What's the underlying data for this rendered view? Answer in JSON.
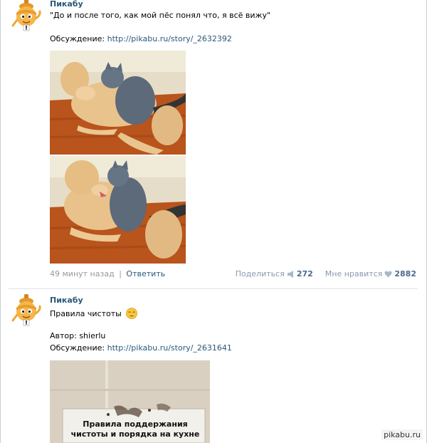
{
  "posts": [
    {
      "author": "Пикабу",
      "title": "\"До и после того, как мой пёс понял что, я всё вижу\"",
      "discussion_label": "Обсуждение:",
      "discussion_link": "http://pikabu.ru/story/_2632392",
      "time": "49 минут назад",
      "separator": "|",
      "reply": "Ответить",
      "share_label": "Поделиться",
      "share_count": "272",
      "like_label": "Мне нравится",
      "like_count": "2882"
    },
    {
      "author": "Пикабу",
      "title": "Правила чистоты",
      "author_label": "Автор: shierlu",
      "discussion_label": "Обсуждение:",
      "discussion_link": "http://pikabu.ru/story/_2631641",
      "sign_text_1": "Правила поддержания",
      "sign_text_2": "чистоты и порядка на кухне"
    }
  ],
  "watermark": "pikabu.ru",
  "colors": {
    "link": "#2b587a",
    "muted": "#999999",
    "divider": "#dae1e8"
  },
  "icons": {
    "avatar": "pikabu-mascot",
    "share": "megaphone-icon",
    "like": "heart-icon",
    "emoji": "relieved-face-emoji"
  }
}
